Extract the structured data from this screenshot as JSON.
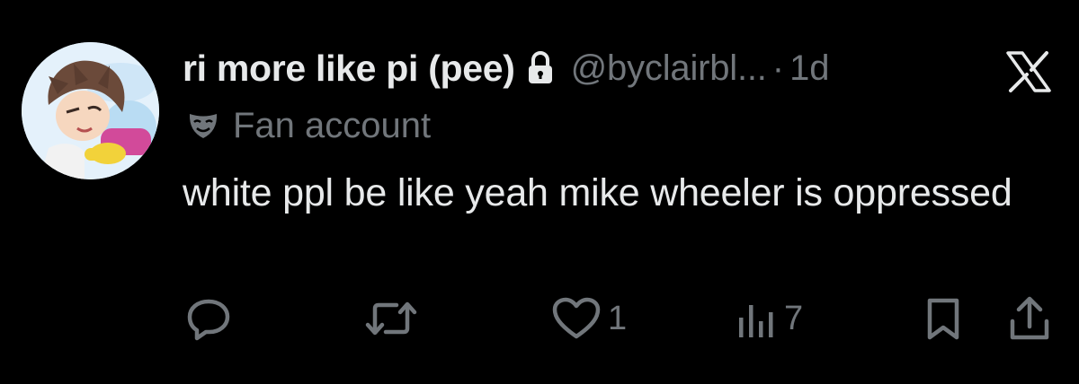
{
  "tweet": {
    "display_name": "ri more like pi (pee)",
    "handle": "@byclairbl...",
    "separator": "·",
    "time": "1d",
    "label": "Fan account",
    "text": "white ppl be like yeah mike wheeler is oppressed",
    "icons": {
      "lock": "lock-icon",
      "label": "mask-icon",
      "brand": "x-logo-icon"
    }
  },
  "actions": {
    "reply": {
      "icon": "reply-icon"
    },
    "repost": {
      "icon": "repost-icon"
    },
    "like": {
      "icon": "heart-icon",
      "count": "1"
    },
    "views": {
      "icon": "analytics-icon",
      "count": "7"
    },
    "bookmark": {
      "icon": "bookmark-icon"
    },
    "share": {
      "icon": "share-icon"
    }
  },
  "colors": {
    "background": "#000000",
    "primary_text": "#e7e9ea",
    "secondary_text": "#71767b"
  }
}
